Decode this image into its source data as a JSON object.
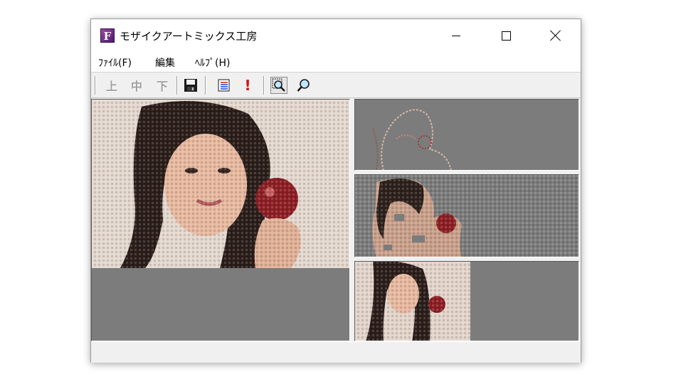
{
  "window": {
    "title": "モザイクアートミックス工房",
    "icon_letter": "F"
  },
  "menu": {
    "items": [
      {
        "label": "ﾌｧｲﾙ(F)"
      },
      {
        "label": "編集"
      },
      {
        "label": "ﾍﾙﾌﾟ(H)"
      }
    ]
  },
  "toolbar": {
    "up_label": "上",
    "middle_label": "中",
    "down_label": "下",
    "alert_label": "!"
  },
  "colors": {
    "pane_background": "#7c7c7c",
    "window_background": "#f0f0f0",
    "icon_purple": "#6b2f8a"
  }
}
